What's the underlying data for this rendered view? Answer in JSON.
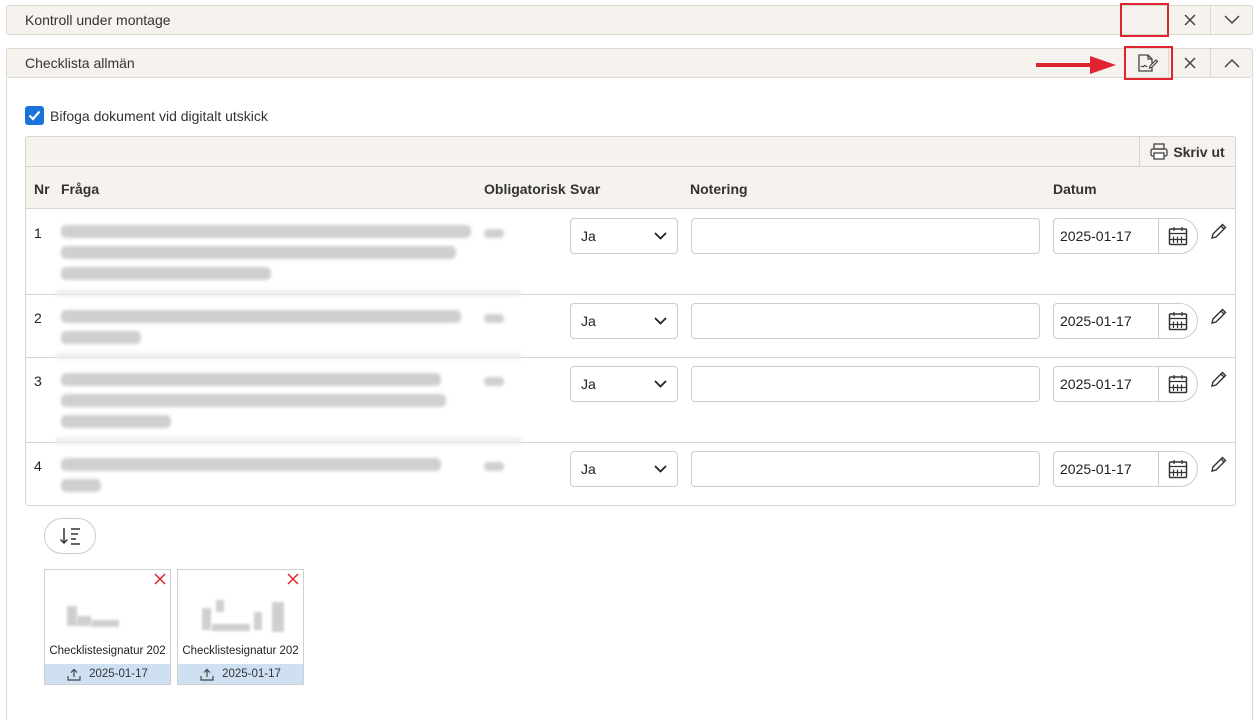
{
  "panels": [
    {
      "title": "Kontroll under montage",
      "expanded": false
    },
    {
      "title": "Checklista allmän",
      "expanded": true
    }
  ],
  "attach_checkbox": {
    "label": "Bifoga dokument vid digitalt utskick",
    "checked": true
  },
  "toolbar": {
    "print_label": "Skriv ut"
  },
  "table": {
    "headers": {
      "nr": "Nr",
      "question": "Fråga",
      "mandatory": "Obligatorisk",
      "answer": "Svar",
      "note": "Notering",
      "date": "Datum"
    },
    "rows": [
      {
        "nr": "1",
        "answer": "Ja",
        "note": "",
        "date": "2025-01-17"
      },
      {
        "nr": "2",
        "answer": "Ja",
        "note": "",
        "date": "2025-01-17"
      },
      {
        "nr": "3",
        "answer": "Ja",
        "note": "",
        "date": "2025-01-17"
      },
      {
        "nr": "4",
        "answer": "Ja",
        "note": "",
        "date": "2025-01-17"
      }
    ]
  },
  "attachments": [
    {
      "name": "Checklistesignatur 202",
      "date": "2025-01-17"
    },
    {
      "name": "Checklistesignatur 202",
      "date": "2025-01-17"
    }
  ],
  "colors": {
    "highlight": "#e0232e",
    "checkbox": "#1a73d9",
    "header_bg": "#f6f3ee",
    "attachment_footer": "#cfe0f3"
  }
}
